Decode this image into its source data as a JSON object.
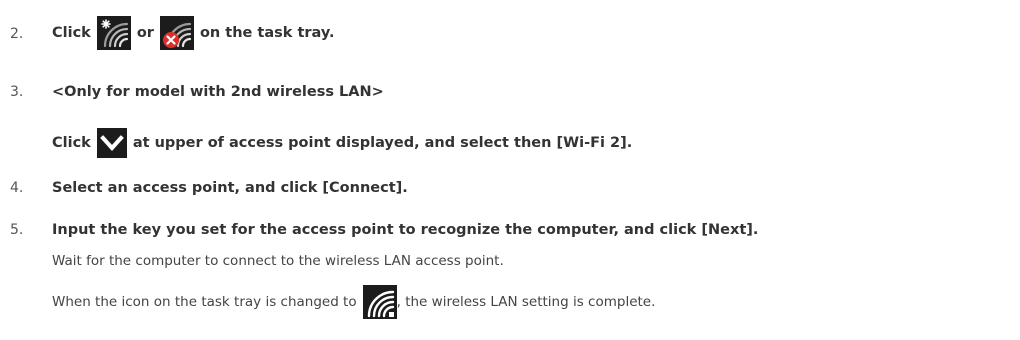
{
  "steps": [
    {
      "num": "2.",
      "text_a": "Click",
      "text_b": "or",
      "text_c": "on the task tray."
    },
    {
      "num": "3.",
      "text": "<Only for model with 2nd wireless LAN>",
      "line2_a": "Click",
      "line2_b": "at upper of access point displayed, and select then [Wi-Fi 2]."
    },
    {
      "num": "4.",
      "text": "Select an access point, and click [Connect]."
    },
    {
      "num": "5.",
      "text": "Input the key you set for the access point to recognize the computer, and click [Next].",
      "note1": "Wait for the computer to connect to the wireless LAN access point.",
      "note2_a": "When the icon on the task tray is changed to",
      "note2_b": ", the wireless LAN setting is complete."
    }
  ],
  "icons": {
    "wifi_star": "wifi-not-connected-star-icon",
    "wifi_red_x": "wifi-disconnected-red-x-icon",
    "chevron": "chevron-down-icon",
    "wifi_connected": "wifi-connected-icon"
  },
  "colors": {
    "text": "#333333",
    "icon_bg": "#1c1c1c",
    "red_x": "#d9302c"
  }
}
